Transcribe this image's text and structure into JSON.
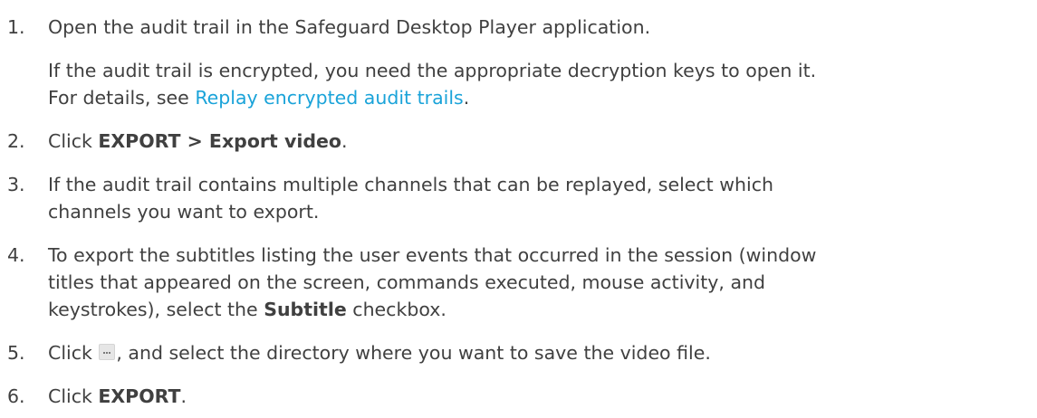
{
  "steps": [
    {
      "number": "1.",
      "text": "Open the audit trail in the Safeguard Desktop Player application.",
      "note": {
        "line1": "If the audit trail is encrypted, you need the appropriate decryption keys to open it.",
        "line2_prefix": "For details, see ",
        "link_text": "Replay encrypted audit trails",
        "line2_suffix": "."
      }
    },
    {
      "number": "2.",
      "prefix": "Click ",
      "bold": "EXPORT > Export video",
      "suffix": "."
    },
    {
      "number": "3.",
      "line1": "If the audit trail contains multiple channels that can be replayed, select which",
      "line2": "channels you want to export."
    },
    {
      "number": "4.",
      "line1": "To export the subtitles listing the user events that occurred in the session (window",
      "line2": "titles that appeared on the screen, commands executed, mouse activity, and",
      "line3_prefix": "keystrokes), select the ",
      "bold": "Subtitle",
      "line3_suffix": " checkbox."
    },
    {
      "number": "5.",
      "prefix": "Click ",
      "icon": "ellipsis-browse-button-icon",
      "suffix": ", and select the directory where you want to save the video file."
    },
    {
      "number": "6.",
      "prefix": "Click ",
      "bold": "EXPORT",
      "suffix": "."
    }
  ],
  "colors": {
    "text": "#404040",
    "link": "#1aa3d9"
  }
}
